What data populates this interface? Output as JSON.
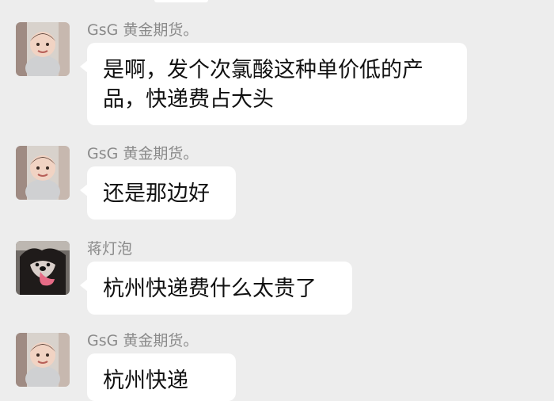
{
  "messages": [
    {
      "sender": "GsG 黄金期货。",
      "avatar": "baby-photo-avatar",
      "text": "是啊，发个次氯酸这种单价低的产品，快递费占大头"
    },
    {
      "sender": "GsG 黄金期货。",
      "avatar": "baby-photo-avatar",
      "text": "还是那边好"
    },
    {
      "sender": "蒋灯泡",
      "avatar": "dog-photo-avatar",
      "text": "杭州快递费什么太贵了"
    },
    {
      "sender": "GsG 黄金期货。",
      "avatar": "baby-photo-avatar",
      "text": "杭州快递"
    }
  ],
  "colors": {
    "background": "#ededed",
    "bubble": "#ffffff",
    "sender_text": "#8a8a8a",
    "message_text": "#111111"
  }
}
